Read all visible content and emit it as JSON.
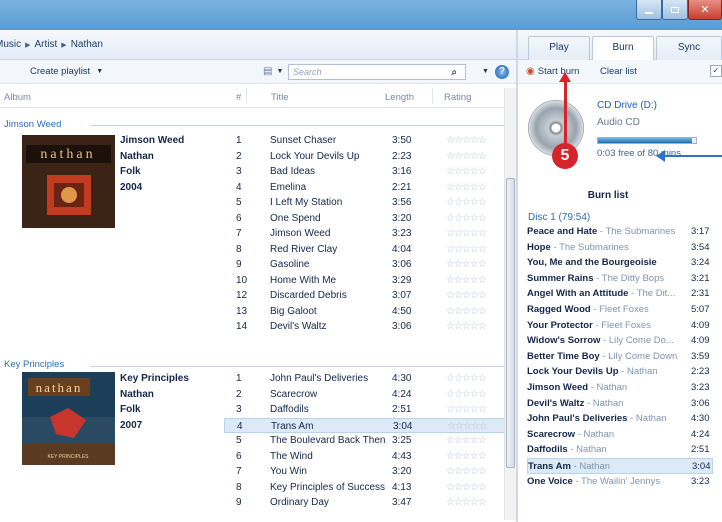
{
  "breadcrumb": {
    "items": [
      "Music",
      "Artist",
      "Nathan"
    ]
  },
  "toolbar": {
    "create_playlist": "Create playlist",
    "search_placeholder": "Search"
  },
  "columns": {
    "album": "Album",
    "number": "#",
    "title": "Title",
    "length": "Length",
    "rating": "Rating"
  },
  "albums": [
    {
      "group_header": "Jimson Weed",
      "meta": [
        "Jimson Weed",
        "Nathan",
        "Folk",
        "2004"
      ],
      "tracks": [
        {
          "n": "1",
          "title": "Sunset Chaser",
          "length": "3:50"
        },
        {
          "n": "2",
          "title": "Lock Your Devils Up",
          "length": "2:23"
        },
        {
          "n": "3",
          "title": "Bad Ideas",
          "length": "3:16"
        },
        {
          "n": "4",
          "title": "Emelina",
          "length": "2:21"
        },
        {
          "n": "5",
          "title": "I Left My Station",
          "length": "3:56"
        },
        {
          "n": "6",
          "title": "One Spend",
          "length": "3:20"
        },
        {
          "n": "7",
          "title": "Jimson Weed",
          "length": "3:23"
        },
        {
          "n": "8",
          "title": "Red River Clay",
          "length": "4:04"
        },
        {
          "n": "9",
          "title": "Gasoline",
          "length": "3:06"
        },
        {
          "n": "10",
          "title": "Home With Me",
          "length": "3:29"
        },
        {
          "n": "12",
          "title": "Discarded Debris",
          "length": "3:07"
        },
        {
          "n": "13",
          "title": "Big Galoot",
          "length": "4:50"
        },
        {
          "n": "14",
          "title": "Devil's Waltz",
          "length": "3:06"
        }
      ]
    },
    {
      "group_header": "Key Principles",
      "meta": [
        "Key Principles",
        "Nathan",
        "Folk",
        "2007"
      ],
      "tracks": [
        {
          "n": "1",
          "title": "John Paul's Deliveries",
          "length": "4:30"
        },
        {
          "n": "2",
          "title": "Scarecrow",
          "length": "4:24"
        },
        {
          "n": "3",
          "title": "Daffodils",
          "length": "2:51"
        },
        {
          "n": "4",
          "title": "Trans Am",
          "length": "3:04"
        },
        {
          "n": "5",
          "title": "The Boulevard Back Then",
          "length": "3:25"
        },
        {
          "n": "6",
          "title": "The Wind",
          "length": "4:43"
        },
        {
          "n": "7",
          "title": "You Win",
          "length": "3:20"
        },
        {
          "n": "8",
          "title": "Key Principles of Success",
          "length": "4:13"
        },
        {
          "n": "9",
          "title": "Ordinary Day",
          "length": "3:47"
        }
      ]
    }
  ],
  "tabs": [
    "Play",
    "Burn",
    "Sync"
  ],
  "active_tab": "Burn",
  "burn_toolbar": {
    "start_burn": "Start burn",
    "clear_list": "Clear list"
  },
  "drive": {
    "name": "CD Drive (D:)",
    "type": "Audio CD",
    "free": "0:03 free of 80 mins",
    "used_fraction": 0.96
  },
  "burn_list": {
    "header": "Burn list",
    "disc": "Disc 1 (79:54)",
    "items": [
      {
        "title": "Peace and Hate",
        "artist": " - The Submarines",
        "length": "3:17"
      },
      {
        "title": "Hope",
        "artist": " - The Submarines",
        "length": "3:54"
      },
      {
        "title": "You, Me and the Bourgeoisie",
        "artist": "",
        "length": "3:24"
      },
      {
        "title": "Summer Rains",
        "artist": " - The Ditty Bops",
        "length": "3:21"
      },
      {
        "title": "Angel With an Attitude",
        "artist": " - The Dit...",
        "length": "2:31"
      },
      {
        "title": "Ragged Wood",
        "artist": " - Fleet Foxes",
        "length": "5:07"
      },
      {
        "title": "Your Protector",
        "artist": " - Fleet Foxes",
        "length": "4:09"
      },
      {
        "title": "Widow's Sorrow",
        "artist": " - Lily Come Do...",
        "length": "4:09"
      },
      {
        "title": "Better Time Boy",
        "artist": " - Lily Come Down",
        "length": "3:59"
      },
      {
        "title": "Lock Your Devils Up",
        "artist": " - Nathan",
        "length": "2:23"
      },
      {
        "title": "Jimson Weed",
        "artist": " - Nathan",
        "length": "3:23"
      },
      {
        "title": "Devil's Waltz",
        "artist": " - Nathan",
        "length": "3:06"
      },
      {
        "title": "John Paul's Deliveries",
        "artist": " - Nathan",
        "length": "4:30"
      },
      {
        "title": "Scarecrow",
        "artist": " - Nathan",
        "length": "4:24"
      },
      {
        "title": "Daffodils",
        "artist": " - Nathan",
        "length": "2:51"
      },
      {
        "title": "Trans Am",
        "artist": " - Nathan",
        "length": "3:04"
      },
      {
        "title": "One Voice",
        "artist": " - The Wailin' Jennys",
        "length": "3:23"
      }
    ]
  },
  "callout": {
    "step": "5"
  },
  "album_art": {
    "art1_text": "nathan",
    "art2_text": "nathan",
    "art2_caption": "KEY PRINCIPLES"
  },
  "colors": {
    "accent": "#2c6cb3",
    "callout_red": "#d6242b",
    "selection": "#dceaf7"
  }
}
